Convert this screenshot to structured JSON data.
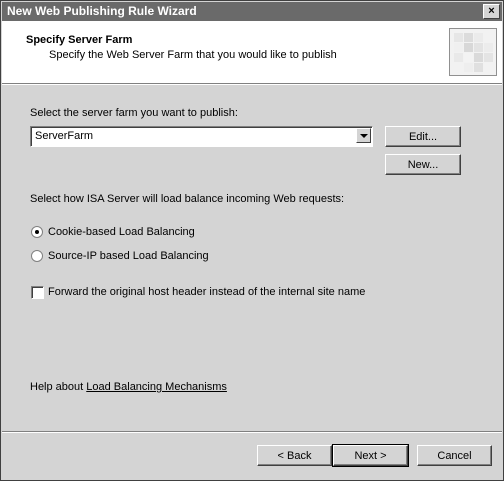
{
  "window": {
    "title": "New Web Publishing Rule Wizard",
    "close_label": "×"
  },
  "header": {
    "title": "Specify Server Farm",
    "subtitle": "Specify the Web Server Farm that you would like to publish"
  },
  "farm": {
    "prompt": "Select the server farm you want to publish:",
    "selected": "ServerFarm",
    "edit_label": "Edit...",
    "new_label": "New..."
  },
  "load_balance": {
    "prompt": "Select how ISA Server will load balance incoming Web requests:",
    "options": [
      {
        "label": "Cookie-based Load Balancing",
        "checked": true
      },
      {
        "label": "Source-IP based Load Balancing",
        "checked": false
      }
    ]
  },
  "forward_header": {
    "label": "Forward the original host header instead of the internal site name",
    "checked": false
  },
  "help": {
    "prefix": "Help about ",
    "link": "Load Balancing Mechanisms"
  },
  "footer": {
    "back_label": "< Back",
    "next_label": "Next >",
    "cancel_label": "Cancel"
  }
}
